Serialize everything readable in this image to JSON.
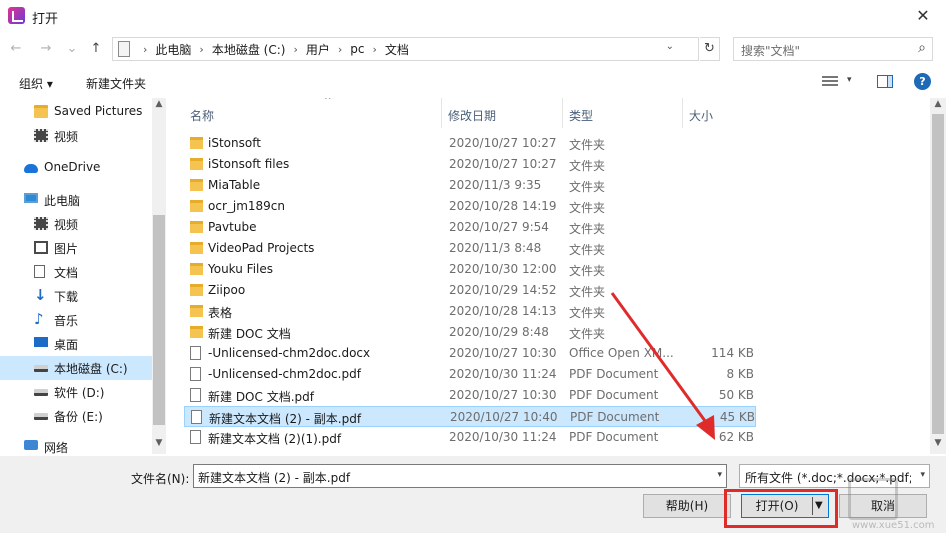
{
  "window": {
    "title": "打开",
    "close": "✕"
  },
  "nav": {
    "back": "←",
    "forward": "→",
    "recent": "⌄",
    "up": "↑"
  },
  "address": {
    "crumbs": [
      "此电脑",
      "本地磁盘 (C:)",
      "用户",
      "pc",
      "文档"
    ],
    "separator": "›",
    "dropdown": "⌄",
    "refresh": "↻"
  },
  "search": {
    "placeholder": "搜索\"文档\"",
    "icon": "⌕"
  },
  "toolbar": {
    "organize": "组织 ▾",
    "new_folder": "新建文件夹",
    "view_dropdown": "▾",
    "help": "?"
  },
  "sidebar": {
    "items": [
      {
        "label": "Saved Pictures",
        "icon": "folder-icon",
        "type": "folder"
      },
      {
        "label": "视频",
        "icon": "video-icon",
        "type": "video"
      },
      {
        "label": "OneDrive",
        "icon": "cloud-icon",
        "type": "cloud"
      },
      {
        "label": "此电脑",
        "icon": "computer-icon",
        "type": "pc"
      },
      {
        "label": "视频",
        "icon": "video-icon",
        "type": "video"
      },
      {
        "label": "图片",
        "icon": "picture-icon",
        "type": "pic"
      },
      {
        "label": "文档",
        "icon": "document-icon",
        "type": "doc"
      },
      {
        "label": "下载",
        "icon": "download-icon",
        "type": "down",
        "glyph": "↓"
      },
      {
        "label": "音乐",
        "icon": "music-icon",
        "type": "music",
        "glyph": "♪"
      },
      {
        "label": "桌面",
        "icon": "desktop-icon",
        "type": "desk"
      },
      {
        "label": "本地磁盘 (C:)",
        "icon": "drive-icon",
        "type": "drive",
        "selected": true
      },
      {
        "label": "软件 (D:)",
        "icon": "drive-icon",
        "type": "drive"
      },
      {
        "label": "备份 (E:)",
        "icon": "drive-icon",
        "type": "drive"
      },
      {
        "label": "网络",
        "icon": "network-icon",
        "type": "net"
      }
    ],
    "scroll_up": "▲",
    "scroll_down": "▼"
  },
  "columns": {
    "name": "名称",
    "date": "修改日期",
    "type": "类型",
    "size": "大小",
    "sort_arrow": "^"
  },
  "files": [
    {
      "name": "iStonsoft",
      "date": "2020/10/27 10:27",
      "type": "文件夹",
      "size": "",
      "kind": "folder"
    },
    {
      "name": "iStonsoft files",
      "date": "2020/10/27 10:27",
      "type": "文件夹",
      "size": "",
      "kind": "folder"
    },
    {
      "name": "MiaTable",
      "date": "2020/11/3 9:35",
      "type": "文件夹",
      "size": "",
      "kind": "folder"
    },
    {
      "name": "ocr_jm189cn",
      "date": "2020/10/28 14:19",
      "type": "文件夹",
      "size": "",
      "kind": "folder"
    },
    {
      "name": "Pavtube",
      "date": "2020/10/27 9:54",
      "type": "文件夹",
      "size": "",
      "kind": "folder"
    },
    {
      "name": "VideoPad Projects",
      "date": "2020/11/3 8:48",
      "type": "文件夹",
      "size": "",
      "kind": "folder"
    },
    {
      "name": "Youku Files",
      "date": "2020/10/30 12:00",
      "type": "文件夹",
      "size": "",
      "kind": "folder"
    },
    {
      "name": "Ziipoo",
      "date": "2020/10/29 14:52",
      "type": "文件夹",
      "size": "",
      "kind": "folder"
    },
    {
      "name": "表格",
      "date": "2020/10/28 14:13",
      "type": "文件夹",
      "size": "",
      "kind": "folder"
    },
    {
      "name": "新建 DOC 文档",
      "date": "2020/10/29 8:48",
      "type": "文件夹",
      "size": "",
      "kind": "folder"
    },
    {
      "name": "-Unlicensed-chm2doc.docx",
      "date": "2020/10/27 10:30",
      "type": "Office Open XM...",
      "size": "114 KB",
      "kind": "file"
    },
    {
      "name": "-Unlicensed-chm2doc.pdf",
      "date": "2020/10/30 11:24",
      "type": "PDF Document",
      "size": "8 KB",
      "kind": "file"
    },
    {
      "name": "新建 DOC 文档.pdf",
      "date": "2020/10/27 10:30",
      "type": "PDF Document",
      "size": "50 KB",
      "kind": "file"
    },
    {
      "name": "新建文本文档 (2) - 副本.pdf",
      "date": "2020/10/27 10:40",
      "type": "PDF Document",
      "size": "45 KB",
      "kind": "file",
      "selected": true
    },
    {
      "name": "新建文本文档 (2)(1).pdf",
      "date": "2020/10/30 11:24",
      "type": "PDF Document",
      "size": "62 KB",
      "kind": "file"
    }
  ],
  "bottom": {
    "filename_label": "文件名(N):",
    "filename_value": "新建文本文档 (2) - 副本.pdf",
    "filetype_value": "所有文件 (*.doc;*.docx;*.pdf;*",
    "dropdown": "▾",
    "help_button": "帮助(H)",
    "open_button": "打开(O)",
    "open_dropdown": "▼",
    "cancel_button": "取消"
  },
  "watermark": {
    "text": "www.xue51.com"
  },
  "colors": {
    "accent": "#0078d7",
    "selection": "#cce8ff",
    "annotation": "#e02b2b"
  }
}
